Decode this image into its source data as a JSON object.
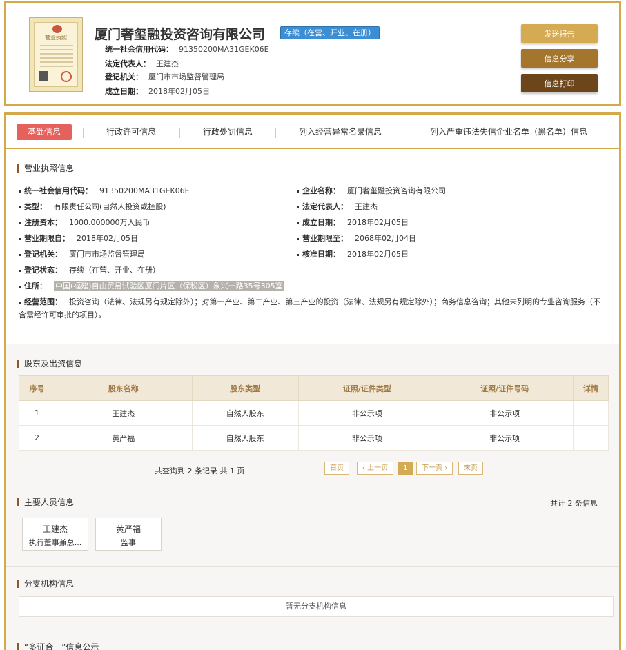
{
  "header": {
    "license_thumb_title": "营业执照",
    "company_name": "厦门奢玺融投资咨询有限公司",
    "status": "存续（在营、开业、在册）",
    "fields": [
      {
        "label": "统一社会信用代码：",
        "value": "91350200MA31GEK06E"
      },
      {
        "label": "法定代表人：",
        "value": "王建杰"
      },
      {
        "label": "登记机关：",
        "value": "厦门市市场监督管理局"
      },
      {
        "label": "成立日期：",
        "value": "2018年02月05日"
      }
    ],
    "buttons": {
      "report": "发送报告",
      "share": "信息分享",
      "print": "信息打印"
    }
  },
  "tabs": [
    "基础信息",
    "行政许可信息",
    "行政处罚信息",
    "列入经营异常名录信息",
    "列入严重违法失信企业名单（黑名单）信息"
  ],
  "license_section": {
    "title": "营业执照信息",
    "left": [
      {
        "label": "统一社会信用代码：",
        "value": "91350200MA31GEK06E"
      },
      {
        "label": "类型：",
        "value": "有限责任公司(自然人投资或控股)"
      },
      {
        "label": "注册资本：",
        "value": "1000.000000万人民币"
      },
      {
        "label": "营业期限自：",
        "value": "2018年02月05日"
      },
      {
        "label": "登记机关：",
        "value": "厦门市市场监督管理局"
      },
      {
        "label": "登记状态：",
        "value": "存续（在营、开业、在册）"
      }
    ],
    "right": [
      {
        "label": "企业名称：",
        "value": "厦门奢玺融投资咨询有限公司"
      },
      {
        "label": "法定代表人：",
        "value": "王建杰"
      },
      {
        "label": "成立日期：",
        "value": "2018年02月05日"
      },
      {
        "label": "营业期限至：",
        "value": "2068年02月04日"
      },
      {
        "label": "核准日期：",
        "value": "2018年02月05日"
      }
    ],
    "address_label": "住所：",
    "address": "中国(福建)自由贸易试验区厦门片区（保税区）象兴一路35号305室",
    "scope_label": "经营范围：",
    "scope": "投资咨询（法律、法规另有规定除外）；对第一产业、第二产业、第三产业的投资（法律、法规另有规定除外）；商务信息咨询；其他未列明的专业咨询服务（不含需经许可审批的项目）。"
  },
  "shareholders": {
    "title": "股东及出资信息",
    "columns": [
      "序号",
      "股东名称",
      "股东类型",
      "证照/证件类型",
      "证照/证件号码",
      "详情"
    ],
    "rows": [
      [
        "1",
        "王建杰",
        "自然人股东",
        "非公示项",
        "非公示项",
        ""
      ],
      [
        "2",
        "黄严福",
        "自然人股东",
        "非公示项",
        "非公示项",
        ""
      ]
    ],
    "pager_info": "共查询到 2 条记录 共 1 页",
    "pager": {
      "first": "首页",
      "prev": "‹ 上一页",
      "current": "1",
      "next": "下一页 ›",
      "last": "末页"
    }
  },
  "personnel": {
    "title": "主要人员信息",
    "total": "共计 2 条信息",
    "people": [
      {
        "name": "王建杰",
        "role": "执行董事兼总..."
      },
      {
        "name": "黄严福",
        "role": "监事"
      }
    ]
  },
  "branches": {
    "title": "分支机构信息",
    "empty": "暂无分支机构信息"
  },
  "multi_cert": {
    "title": "“多证合一”信息公示"
  }
}
